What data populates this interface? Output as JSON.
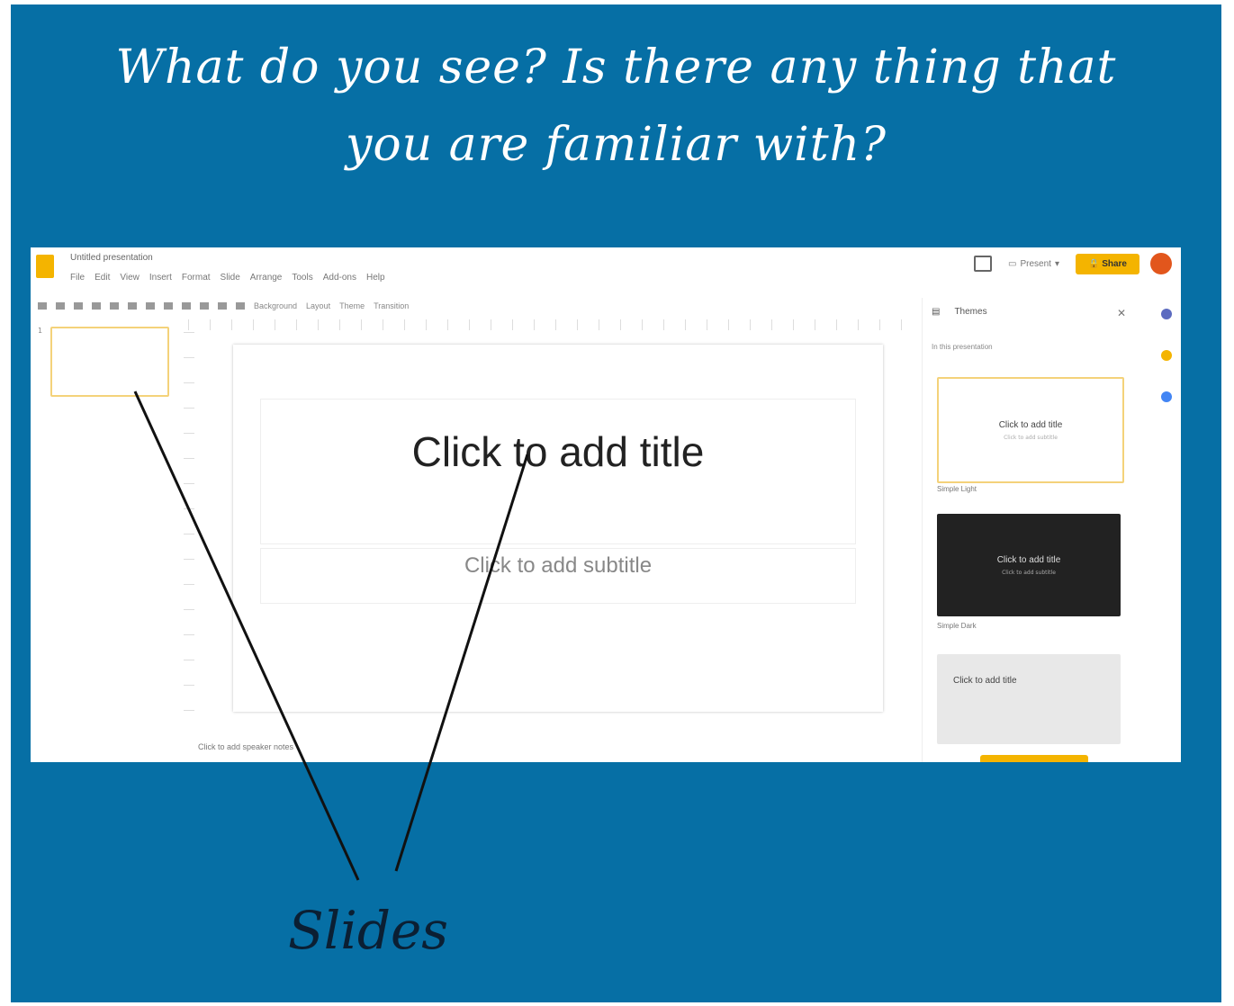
{
  "heading": {
    "line1": "What do you see? Is there any thing that",
    "line2": "you are familiar with?"
  },
  "caption": "Slides",
  "colors": {
    "background": "#066fa5",
    "accent": "#f4b400",
    "avatar": "#e2561c"
  },
  "screenshot": {
    "doc_title": "Untitled presentation",
    "menu": [
      "File",
      "Edit",
      "View",
      "Insert",
      "Format",
      "Slide",
      "Arrange",
      "Tools",
      "Add-ons",
      "Help"
    ],
    "toolbar": [
      "Background",
      "Layout",
      "Theme",
      "Transition"
    ],
    "present_label": "Present",
    "share_label": "Share",
    "filmstrip": {
      "slide_number": "1"
    },
    "canvas": {
      "title_placeholder": "Click to add title",
      "subtitle_placeholder": "Click to add subtitle"
    },
    "speaker_notes": "Click to add speaker notes",
    "themes_panel": {
      "title": "Themes",
      "subtitle": "In this presentation",
      "themes": [
        {
          "name": "Simple Light",
          "title": "Click to add title",
          "subtitle": "Click to add subtitle",
          "bg": "#ffffff"
        },
        {
          "name": "Simple Dark",
          "title": "Click to add title",
          "subtitle": "Click to add subtitle",
          "bg": "#222222"
        },
        {
          "name": "",
          "title": "Click to add title",
          "subtitle": "",
          "bg": "#e8e8e8"
        }
      ]
    }
  }
}
